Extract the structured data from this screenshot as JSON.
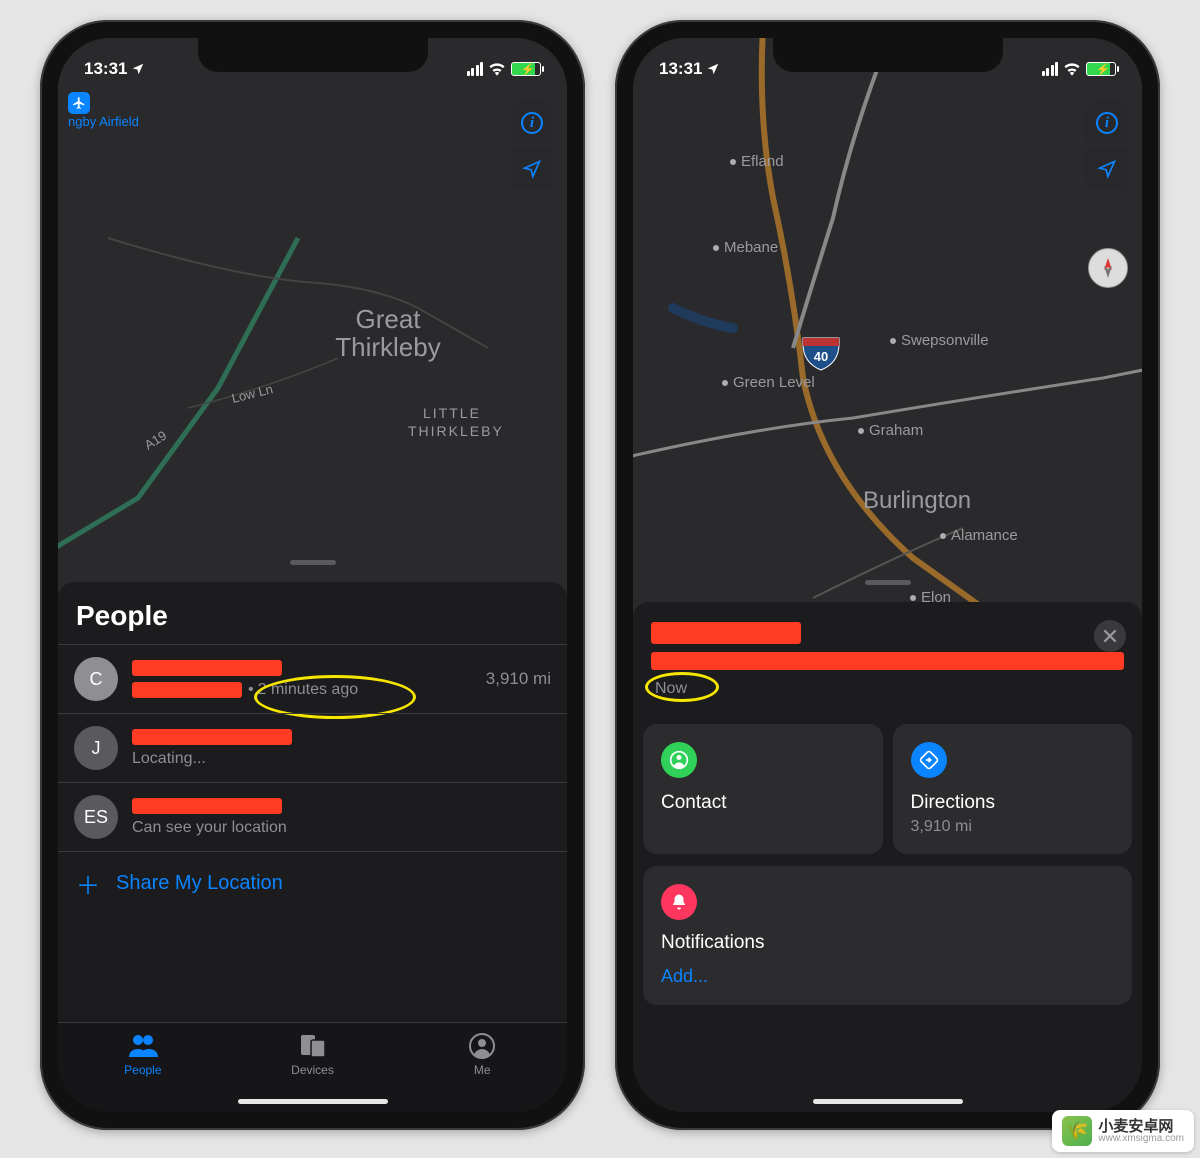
{
  "status": {
    "time": "13:31",
    "location_arrow": "➤"
  },
  "left_phone": {
    "poi_label": "ngby Airfield",
    "map_labels": {
      "great_thirkleby": "Great\nThirkleby",
      "little_thirkleby": "LITTLE\nTHIRKLEBY",
      "low_ln": "Low Ln",
      "a19": "A19"
    },
    "sheet_title": "People",
    "people": [
      {
        "initials": "C",
        "timestamp": "2 minutes ago",
        "distance": "3,910 mi"
      },
      {
        "initials": "J",
        "status": "Locating..."
      },
      {
        "initials": "ES",
        "status": "Can see your location"
      }
    ],
    "share_label": "Share My Location",
    "tabs": {
      "people": "People",
      "devices": "Devices",
      "me": "Me"
    }
  },
  "right_phone": {
    "map_labels": {
      "efland": "Efland",
      "mebane": "Mebane",
      "swepsonville": "Swepsonville",
      "green_level": "Green Level",
      "graham": "Graham",
      "burlington": "Burlington",
      "alamance": "Alamance",
      "elon": "Elon",
      "i40": "40"
    },
    "now": "Now",
    "cards": {
      "contact": "Contact",
      "directions": "Directions",
      "directions_sub": "3,910 mi",
      "notifications": "Notifications",
      "add": "Add..."
    }
  },
  "watermark": {
    "brand": "小麦安卓网",
    "domain": "www.xmsigma.com"
  }
}
